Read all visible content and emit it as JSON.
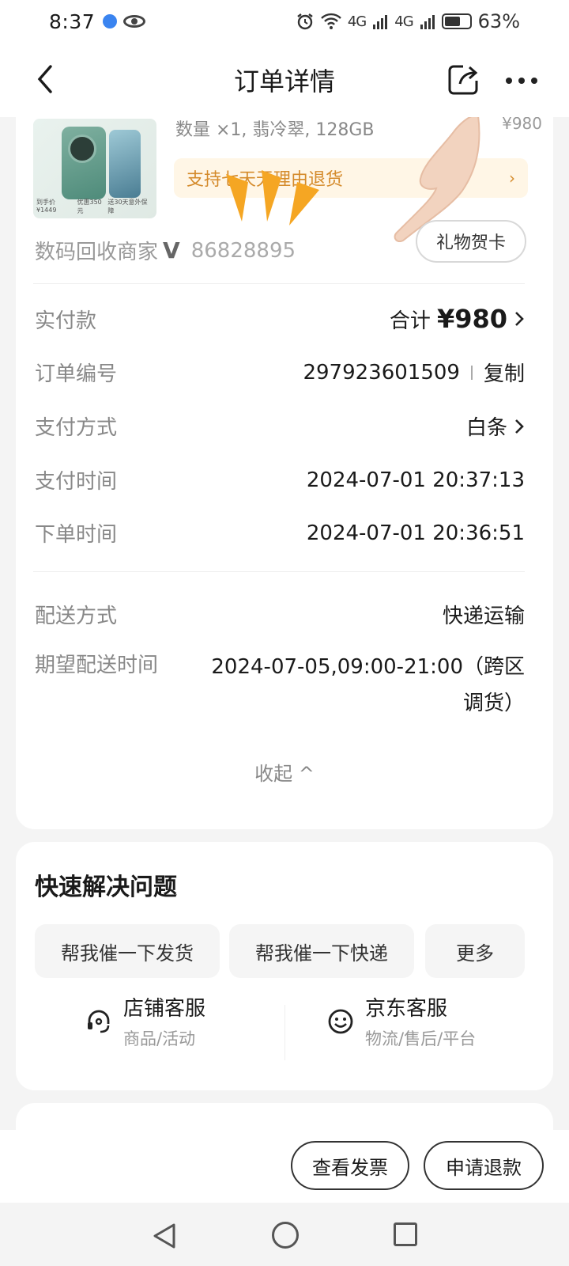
{
  "status_bar": {
    "time": "8:37",
    "signal_a": "4G",
    "signal_b": "4G",
    "battery_percent": "63%",
    "battery_level": 0.63
  },
  "header": {
    "title": "订单详情"
  },
  "product": {
    "specs": "数量 ×1, 翡冷翠, 128GB",
    "price": "¥980",
    "return_text": "支持七天无理由退货",
    "return_arrow": "›",
    "thumb_caption": [
      "到手价 ¥1449",
      "优惠350元",
      "送30天意外保障"
    ]
  },
  "shop": {
    "name": "数码回收商家",
    "badge": "V",
    "id": "86828895",
    "gift_card_label": "礼物贺卡"
  },
  "order_rows": {
    "paid_label": "实付款",
    "paid_prefix": "合计",
    "paid_amount": "¥980",
    "order_no_label": "订单编号",
    "order_no": "297923601509",
    "copy_label": "复制",
    "pay_method_label": "支付方式",
    "pay_method": "白条",
    "pay_time_label": "支付时间",
    "pay_time": "2024-07-01 20:37:13",
    "order_time_label": "下单时间",
    "order_time": "2024-07-01 20:36:51",
    "delivery_label": "配送方式",
    "delivery": "快递运输",
    "expected_label": "期望配送时间",
    "expected": "2024-07-05,09:00-21:00（跨区调货）",
    "collapse_label": "收起 ^"
  },
  "quick_help": {
    "title": "快速解决问题",
    "chips": [
      "帮我催一下发货",
      "帮我催一下快递",
      "更多"
    ],
    "shop_service_title": "店铺客服",
    "shop_service_sub": "商品/活动",
    "jd_service_title": "京东客服",
    "jd_service_sub": "物流/售后/平台"
  },
  "actions": {
    "invoice": "查看发票",
    "refund": "申请退款"
  },
  "colors": {
    "accent_orange": "#d48a2a",
    "return_bg": "#fff6e6"
  }
}
